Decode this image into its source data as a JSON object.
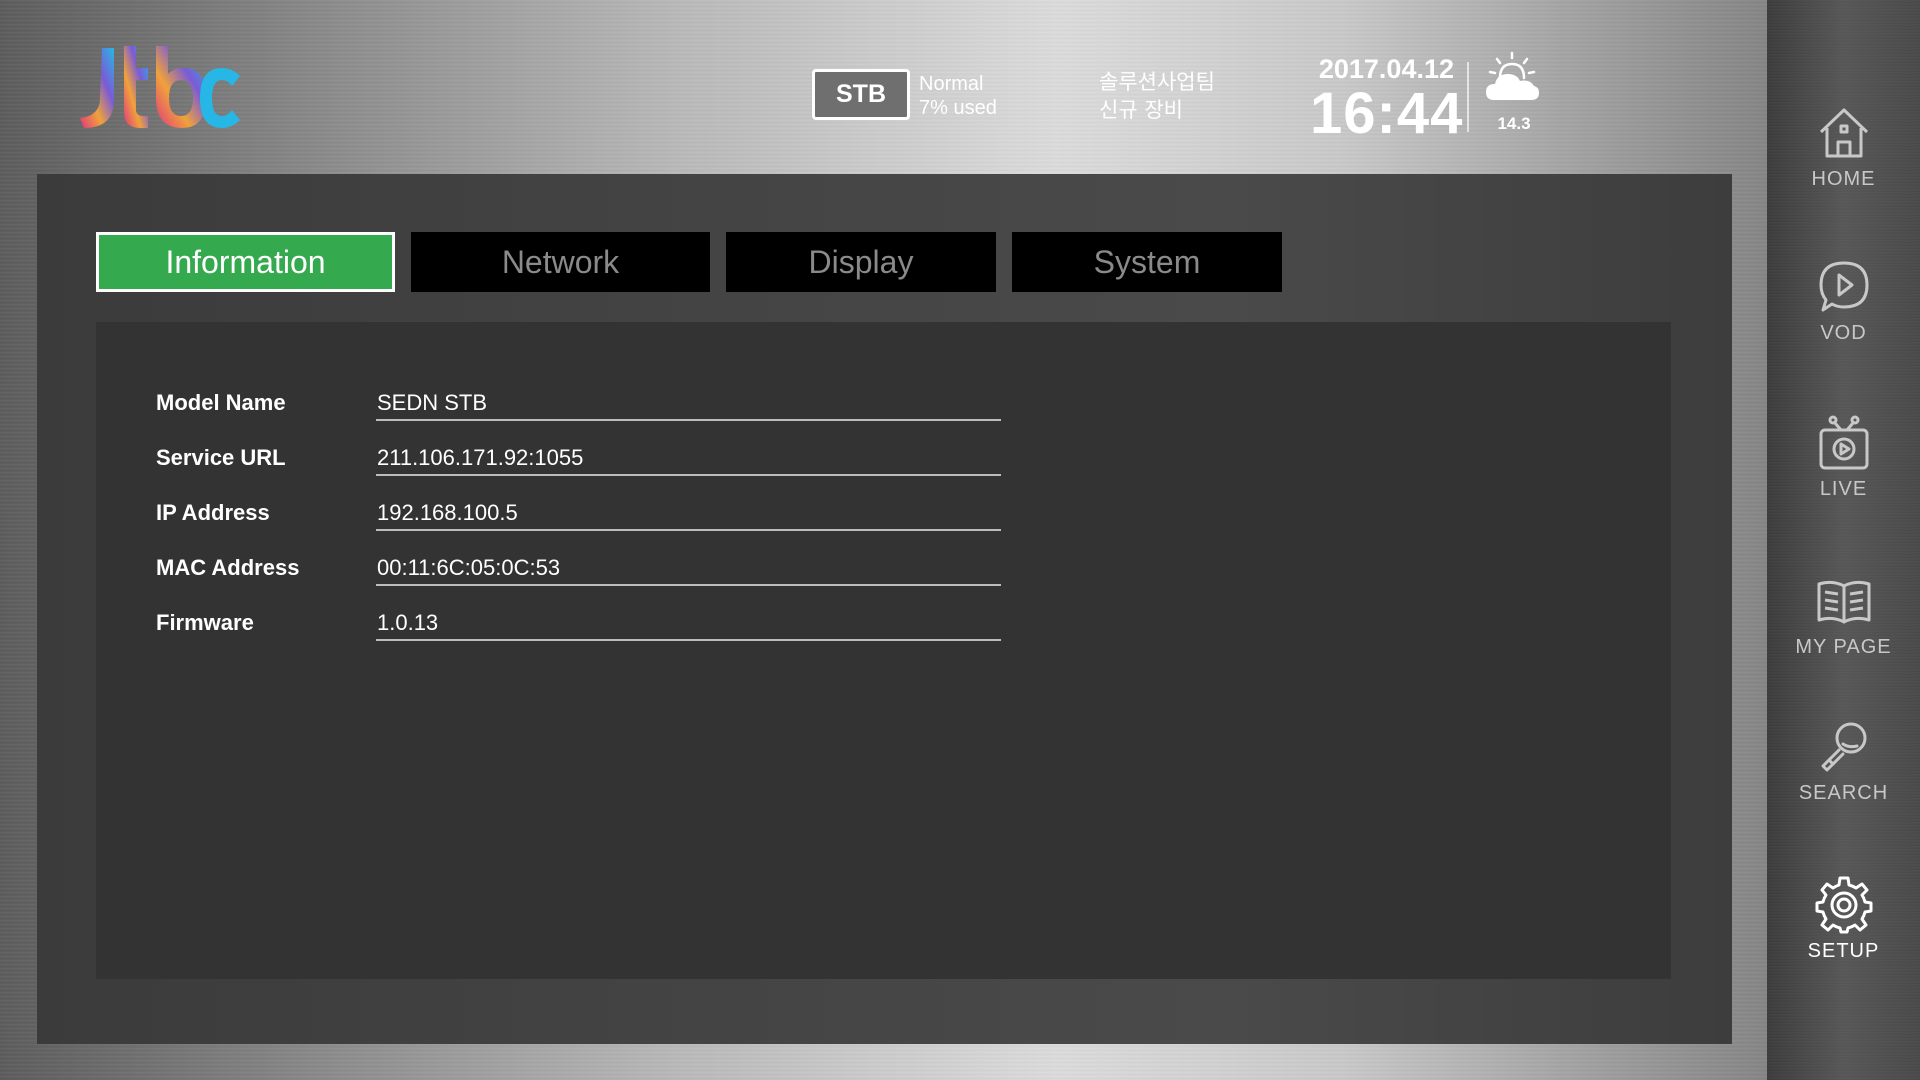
{
  "header": {
    "logo_text": "jtbc",
    "stb_badge": "STB",
    "stb_status": "Normal",
    "stb_usage": "7% used",
    "team_line1": "솔루션사업팀",
    "team_line2": "신규 장비",
    "date": "2017.04.12",
    "time": "16:44",
    "weather_icon": "sun-cloud-icon",
    "temperature": "14.3"
  },
  "tabs": [
    {
      "label": "Information",
      "active": true
    },
    {
      "label": "Network",
      "active": false
    },
    {
      "label": "Display",
      "active": false
    },
    {
      "label": "System",
      "active": false
    }
  ],
  "info": {
    "rows": [
      {
        "label": "Model Name",
        "value": "SEDN STB"
      },
      {
        "label": "Service URL",
        "value": "211.106.171.92:1055"
      },
      {
        "label": "IP Address",
        "value": "192.168.100.5"
      },
      {
        "label": "MAC Address",
        "value": "00:11:6C:05:0C:53"
      },
      {
        "label": "Firmware",
        "value": "1.0.13"
      }
    ]
  },
  "sidebar": {
    "items": [
      {
        "label": "HOME",
        "icon": "home-icon"
      },
      {
        "label": "VOD",
        "icon": "play-chat-icon"
      },
      {
        "label": "LIVE",
        "icon": "tv-icon"
      },
      {
        "label": "MY PAGE",
        "icon": "book-icon"
      },
      {
        "label": "SEARCH",
        "icon": "magnifier-icon"
      },
      {
        "label": "SETUP",
        "icon": "gear-icon",
        "active": true
      }
    ]
  },
  "colors": {
    "active_tab": "#35a94e",
    "panel": "#333333"
  }
}
